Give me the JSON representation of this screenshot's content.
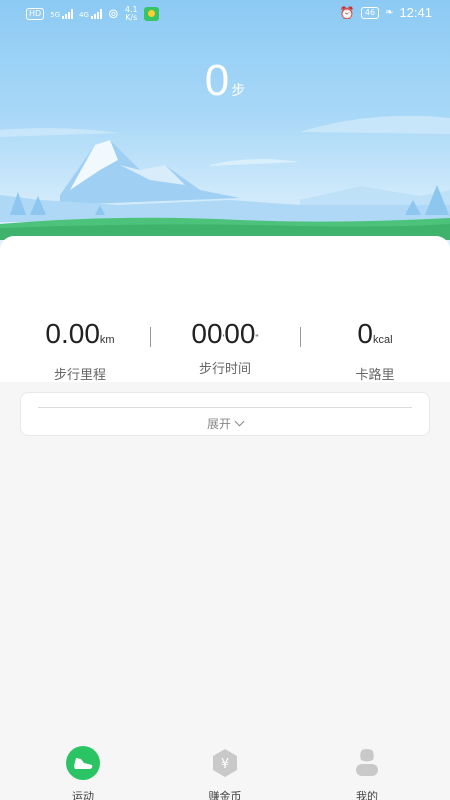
{
  "status_bar": {
    "left": {
      "hd": "HD",
      "net1": "5G",
      "net2": "4G",
      "speed_top": "4.1",
      "speed_bottom": "K/s"
    },
    "right": {
      "battery": "46",
      "time": "12:41"
    }
  },
  "steps": {
    "count": "0",
    "unit": "步"
  },
  "stats": [
    {
      "value": "0.00",
      "unit": "km",
      "label": "步行里程"
    },
    {
      "value_min": "00",
      "min_mark": "'",
      "value_sec": "00",
      "sec_mark": "\"",
      "label": "步行时间"
    },
    {
      "value": "0",
      "unit": "kcal",
      "label": "卡路里"
    }
  ],
  "expand": {
    "label": "展开"
  },
  "tabbar": {
    "items": [
      {
        "label": "运动",
        "icon": "shoe-icon",
        "active": true
      },
      {
        "label": "赚金币",
        "icon": "coin-yen-icon",
        "active": false
      },
      {
        "label": "我的",
        "icon": "person-icon",
        "active": false
      }
    ]
  },
  "colors": {
    "accent": "#2bc464",
    "sky": "#8ccaf4",
    "grass": "#4cc27a"
  }
}
